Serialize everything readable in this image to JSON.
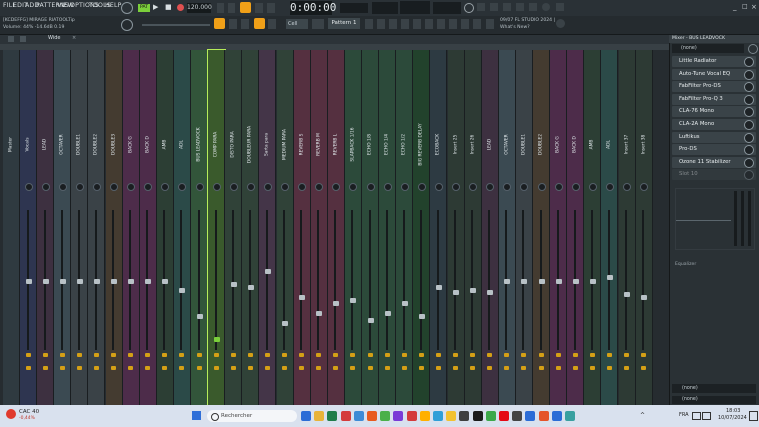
{
  "menu": {
    "items": [
      "FILE",
      "EDIT",
      "ADD",
      "PATTERNS",
      "VIEW",
      "OPTIONS",
      "TOOLS",
      "HELP"
    ]
  },
  "hint_bar": {
    "line1": "[KCDEFFG] MIRAGE RIATOOLTip",
    "line2": "Volume: 44%  -14.6dB  0.19"
  },
  "transport": {
    "pattern_mode": "PAT",
    "tempo": "120.000",
    "time": "0:00:00",
    "pattern": "Pattern 1",
    "snap": "Cell"
  },
  "news": {
    "line1": "09/07  FL STUDIO 2024 |",
    "line2": "What's New?"
  },
  "mixer": {
    "title": "Wide",
    "strips": [
      {
        "label": "Master",
        "color": "#2f3a40"
      },
      {
        "label": "Vocals",
        "color": "#2e3550"
      },
      {
        "label": "LEAD",
        "color": "#3d3040"
      },
      {
        "label": "OCTAVER",
        "color": "#3b4a52"
      },
      {
        "label": "DOUBLE1",
        "color": "#3a4247"
      },
      {
        "label": "DOUBLE2",
        "color": "#3a4247"
      },
      {
        "label": "DOUBLE3",
        "color": "#443b30"
      },
      {
        "label": "BACK G",
        "color": "#4d2c4a"
      },
      {
        "label": "BACK D",
        "color": "#4d2c4a"
      },
      {
        "label": "AMB",
        "color": "#2c3e34"
      },
      {
        "label": "ADL",
        "color": "#2b4a48"
      },
      {
        "label": "BUS LEADVOCK",
        "color": "#32553a"
      },
      {
        "label": "COMP PARA",
        "color": "#3a5a2c"
      },
      {
        "label": "DISTO PARA",
        "color": "#304238"
      },
      {
        "label": "DOUBLEUR PARA",
        "color": "#304238"
      },
      {
        "label": "Sarta para",
        "color": "#443548"
      },
      {
        "label": "MEDIUM PARA",
        "color": "#304238"
      },
      {
        "label": "REVERB S",
        "color": "#553040"
      },
      {
        "label": "REVERB M",
        "color": "#553040"
      },
      {
        "label": "REVERB L",
        "color": "#553040"
      },
      {
        "label": "SLAPBACK 1/16",
        "color": "#2c4a3a"
      },
      {
        "label": "ECHO 1/8",
        "color": "#2c4a3a"
      },
      {
        "label": "ECHO 1/4",
        "color": "#2c4a3a"
      },
      {
        "label": "ECHO 1/2",
        "color": "#2c4a3a"
      },
      {
        "label": "BIG REVERB DELAY",
        "color": "#22422c"
      },
      {
        "label": "ECOBACK",
        "color": "#2d3a42"
      },
      {
        "label": "Insert 25",
        "color": "#2d3a34"
      },
      {
        "label": "Insert 26",
        "color": "#2d3a34"
      },
      {
        "label": "LEAD",
        "color": "#3d3040"
      },
      {
        "label": "OCTAVER",
        "color": "#3b4a52"
      },
      {
        "label": "DOUBLE1",
        "color": "#3a4247"
      },
      {
        "label": "DOUBLE2",
        "color": "#443b30"
      },
      {
        "label": "BACK G",
        "color": "#4d2c4a"
      },
      {
        "label": "BACK D",
        "color": "#4d2c4a"
      },
      {
        "label": "AMB",
        "color": "#2c3e34"
      },
      {
        "label": "ADL",
        "color": "#2b4a48"
      },
      {
        "label": "Insert 37",
        "color": "#2d3a34"
      },
      {
        "label": "Insert 38",
        "color": "#2d3a34"
      }
    ],
    "fader_levels": [
      0.55,
      0.55,
      0.55,
      0.55,
      0.55,
      0.55,
      0.55,
      0.55,
      0.55,
      0.48,
      0.28,
      0.1,
      0.52,
      0.5,
      0.62,
      0.22,
      0.42,
      0.3,
      0.38,
      0.4,
      0.25,
      0.3,
      0.38,
      0.28,
      0.5,
      0.46,
      0.48,
      0.46,
      0.55,
      0.55,
      0.55,
      0.55,
      0.55,
      0.55,
      0.58,
      0.45,
      0.42,
      0.28
    ]
  },
  "inserts_panel": {
    "title": "Mixer - BUS LEADVOCK",
    "preset": "(none)",
    "slots": [
      "Little Radiator",
      "Auto-Tune Vocal EQ",
      "FabFilter Pro-DS",
      "FabFilter Pro-Q 3",
      "CLA-76 Mono",
      "CLA-2A Mono",
      "Luftikus",
      "Pro-DS",
      "Ozone 11 Stabilizer",
      "Slot 10"
    ],
    "eq_label": "Equalizer",
    "out_label": "(none)",
    "out_label2": "(none)"
  },
  "taskbar": {
    "weather_temp": "CAC 40",
    "weather_sub": "-0,44%",
    "search_placeholder": "Rechercher",
    "lang": "FRA",
    "time": "18:03",
    "date": "10/07/2024"
  },
  "colors": {
    "accent_orange": "#f0a018",
    "accent_green": "#7bcf3b",
    "route_yellow": "#d4a016",
    "selected_strip": "#b6ec5a"
  }
}
